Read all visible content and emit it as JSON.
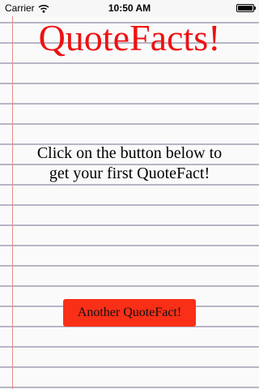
{
  "status_bar": {
    "carrier": "Carrier",
    "time": "10:50 AM",
    "wifi_icon": "wifi-icon",
    "battery_icon": "battery-icon",
    "battery_level": 1.0
  },
  "app": {
    "title": "QuoteFacts!",
    "title_color": "#ee1111",
    "message_line1": "Click on the button below to",
    "message_line2": "get your first QuoteFact!",
    "button_label": "Another QuoteFact!",
    "button_color": "#fa2f17"
  }
}
